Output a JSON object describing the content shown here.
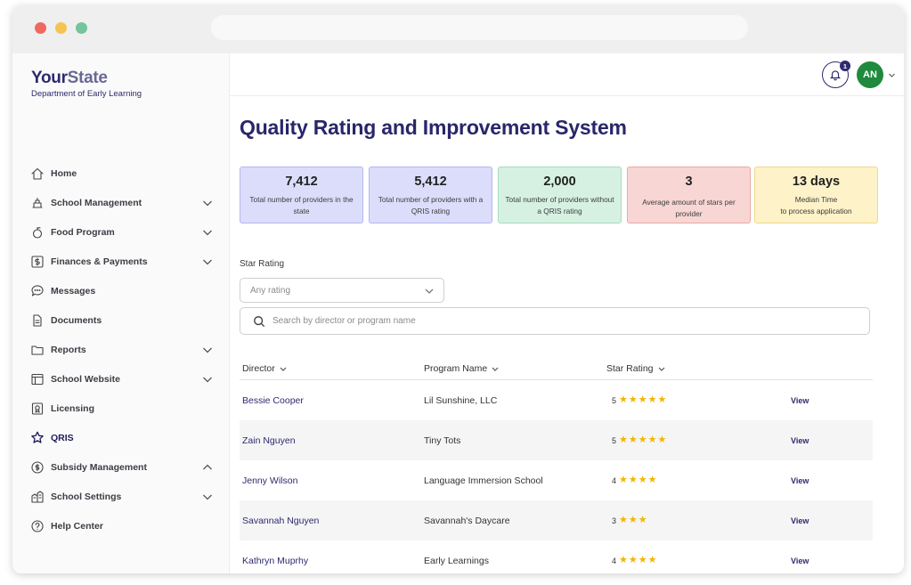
{
  "brand": {
    "name_first": "Your",
    "name_second": "State",
    "subtitle": "Department of Early Learning"
  },
  "sidebar": {
    "items": [
      {
        "label": "Home",
        "icon": "home-icon",
        "expandable": false
      },
      {
        "label": "School Management",
        "icon": "school-management-icon",
        "expandable": true,
        "expanded": false
      },
      {
        "label": "Food Program",
        "icon": "food-icon",
        "expandable": true,
        "expanded": false
      },
      {
        "label": "Finances & Payments",
        "icon": "finances-icon",
        "expandable": true,
        "expanded": false
      },
      {
        "label": "Messages",
        "icon": "messages-icon",
        "expandable": false
      },
      {
        "label": "Documents",
        "icon": "documents-icon",
        "expandable": false
      },
      {
        "label": "Reports",
        "icon": "reports-icon",
        "expandable": true,
        "expanded": false
      },
      {
        "label": "School Website",
        "icon": "website-icon",
        "expandable": true,
        "expanded": false
      },
      {
        "label": "Licensing",
        "icon": "licensing-icon",
        "expandable": false
      },
      {
        "label": "QRIS",
        "icon": "star-icon",
        "expandable": false,
        "active": true
      },
      {
        "label": "Subsidy Management",
        "icon": "subsidy-icon",
        "expandable": true,
        "expanded": true
      },
      {
        "label": "School Settings",
        "icon": "settings-icon",
        "expandable": true,
        "expanded": false
      },
      {
        "label": "Help Center",
        "icon": "help-icon",
        "expandable": false
      }
    ]
  },
  "header": {
    "notification_count": "1",
    "avatar_initials": "AN"
  },
  "page": {
    "title": "Quality Rating and Improvement System"
  },
  "stats": [
    {
      "value": "7,412",
      "label": "Total number of providers in the state"
    },
    {
      "value": "5,412",
      "label": "Total number of providers with a QRIS rating"
    },
    {
      "value": "2,000",
      "label": "Total number of providers without a QRIS rating"
    },
    {
      "value": "3",
      "label": "Average amount of stars per provider"
    },
    {
      "value": "13 days",
      "label_line1": "Median Time",
      "label_line2": "to process application"
    }
  ],
  "filters": {
    "star_rating_label": "Star Rating",
    "star_rating_value": "Any rating",
    "search_placeholder": "Search by director or program name"
  },
  "table": {
    "columns": [
      "Director",
      "Program Name",
      "Star Rating"
    ],
    "view_label": "View",
    "rows": [
      {
        "director": "Bessie Cooper",
        "program": "Lil Sunshine, LLC",
        "rating": "5"
      },
      {
        "director": "Zain Nguyen",
        "program": "Tiny Tots",
        "rating": "5"
      },
      {
        "director": "Jenny Wilson",
        "program": "Language Immersion School",
        "rating": "4"
      },
      {
        "director": "Savannah Nguyen",
        "program": "Savannah's Daycare",
        "rating": "3"
      },
      {
        "director": "Kathryn Muprhy",
        "program": "Early Learnings",
        "rating": "4"
      }
    ]
  },
  "colors": {
    "brand": "#2d2a6e",
    "avatar": "#1e8a3d",
    "star": "#f4b400"
  }
}
